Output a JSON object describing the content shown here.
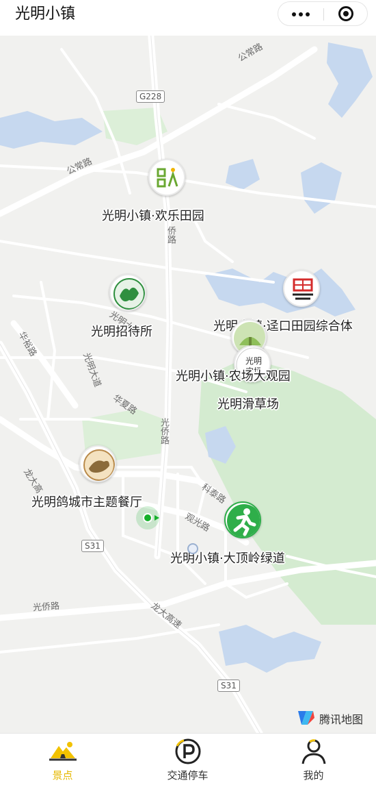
{
  "header": {
    "title": "光明小镇",
    "more_icon": "more-dots-icon",
    "close_icon": "close-circle-icon"
  },
  "map": {
    "road_labels": {
      "gongchang_top": "公常路",
      "gongchang_left": "公常路",
      "qiao_north": "侨路",
      "huayu": "华裕路",
      "guangming_da": "光明大道",
      "huaxia": "华夏路",
      "guangqiao_mid": "光侨路",
      "kejie": "光明大街",
      "longda_left": "龙大高",
      "ketai": "科泰路",
      "guanguang": "观光路",
      "guangqiao_bottom": "光侨路",
      "longda_bottom": "龙大高速"
    },
    "shields": {
      "g228": "G228",
      "s31_left": "S31",
      "s31_bottom": "S31"
    },
    "pois": [
      {
        "id": "happy-farm",
        "label": "光明小镇·欢乐田园"
      },
      {
        "id": "guest-house",
        "label": "光明招待所"
      },
      {
        "id": "dikou-farm",
        "label": "光明小镇·迳口田园综合体"
      },
      {
        "id": "farm-garden",
        "label": "光明小镇·农场大观园",
        "badge": "光明\n农场"
      },
      {
        "id": "grass-ski",
        "label": "光明滑草场"
      },
      {
        "id": "pigeon-restaurant",
        "label": "光明鸽城市主题餐厅"
      },
      {
        "id": "dading-greenway",
        "label": "光明小镇·大顶岭绿道"
      }
    ],
    "attribution": "腾讯地图",
    "colors": {
      "land": "#f1f1ef",
      "park": "#d6ecd2",
      "water": "#c7d9f0",
      "road": "#ffffff"
    }
  },
  "tabs": [
    {
      "label": "景点",
      "icon": "scenic-spot-icon",
      "active": true
    },
    {
      "label": "交通停车",
      "icon": "parking-icon",
      "active": false
    },
    {
      "label": "我的",
      "icon": "user-icon",
      "active": false
    }
  ],
  "accent_color": "#e6b800"
}
